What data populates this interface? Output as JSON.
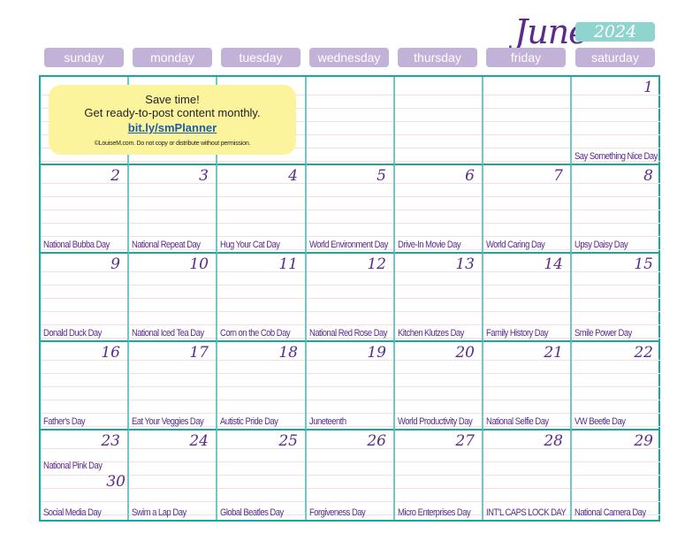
{
  "header": {
    "month": "June",
    "year": "2024"
  },
  "days_of_week": [
    "sunday",
    "monday",
    "tuesday",
    "wednesday",
    "thursday",
    "friday",
    "saturday"
  ],
  "promo": {
    "line1": "Save time!",
    "line2": "Get ready-to-post content monthly.",
    "link": "bit.ly/smPlanner",
    "copyright": "©LouiseM.com. Do not copy or distribute without permission."
  },
  "weeks": [
    [
      {
        "day": "",
        "event": ""
      },
      {
        "day": "",
        "event": ""
      },
      {
        "day": "",
        "event": ""
      },
      {
        "day": "",
        "event": ""
      },
      {
        "day": "",
        "event": ""
      },
      {
        "day": "",
        "event": ""
      },
      {
        "day": "1",
        "event": "Say Something Nice Day"
      }
    ],
    [
      {
        "day": "2",
        "event": "National Bubba Day"
      },
      {
        "day": "3",
        "event": "National Repeat Day"
      },
      {
        "day": "4",
        "event": "Hug Your Cat Day"
      },
      {
        "day": "5",
        "event": "World Environment Day"
      },
      {
        "day": "6",
        "event": "Drive-In Movie Day"
      },
      {
        "day": "7",
        "event": "World Caring Day"
      },
      {
        "day": "8",
        "event": "Upsy Daisy Day"
      }
    ],
    [
      {
        "day": "9",
        "event": "Donald Duck Day"
      },
      {
        "day": "10",
        "event": "National Iced Tea Day"
      },
      {
        "day": "11",
        "event": "Corn on the Cob Day"
      },
      {
        "day": "12",
        "event": "National Red Rose Day"
      },
      {
        "day": "13",
        "event": "Kitchen Klutzes Day"
      },
      {
        "day": "14",
        "event": "Family History Day"
      },
      {
        "day": "15",
        "event": "Smile Power Day"
      }
    ],
    [
      {
        "day": "16",
        "event": "Father's Day"
      },
      {
        "day": "17",
        "event": "Eat Your Veggies Day"
      },
      {
        "day": "18",
        "event": "Autistic Pride Day"
      },
      {
        "day": "19",
        "event": "Juneteenth"
      },
      {
        "day": "20",
        "event": "World Productivity Day"
      },
      {
        "day": "21",
        "event": "National Selfie Day"
      },
      {
        "day": "22",
        "event": "VW Beetle Day"
      }
    ],
    [
      {
        "day": "23",
        "event": "Social Media Day",
        "extra_event": "National Pink Day",
        "extra_day": "30"
      },
      {
        "day": "24",
        "event": "Swim a Lap Day"
      },
      {
        "day": "25",
        "event": "Global Beatles Day"
      },
      {
        "day": "26",
        "event": "Forgiveness Day"
      },
      {
        "day": "27",
        "event": "Micro Enterprises Day"
      },
      {
        "day": "28",
        "event": "INT'L CAPS LOCK DAY"
      },
      {
        "day": "29",
        "event": "National Camera Day"
      }
    ]
  ]
}
